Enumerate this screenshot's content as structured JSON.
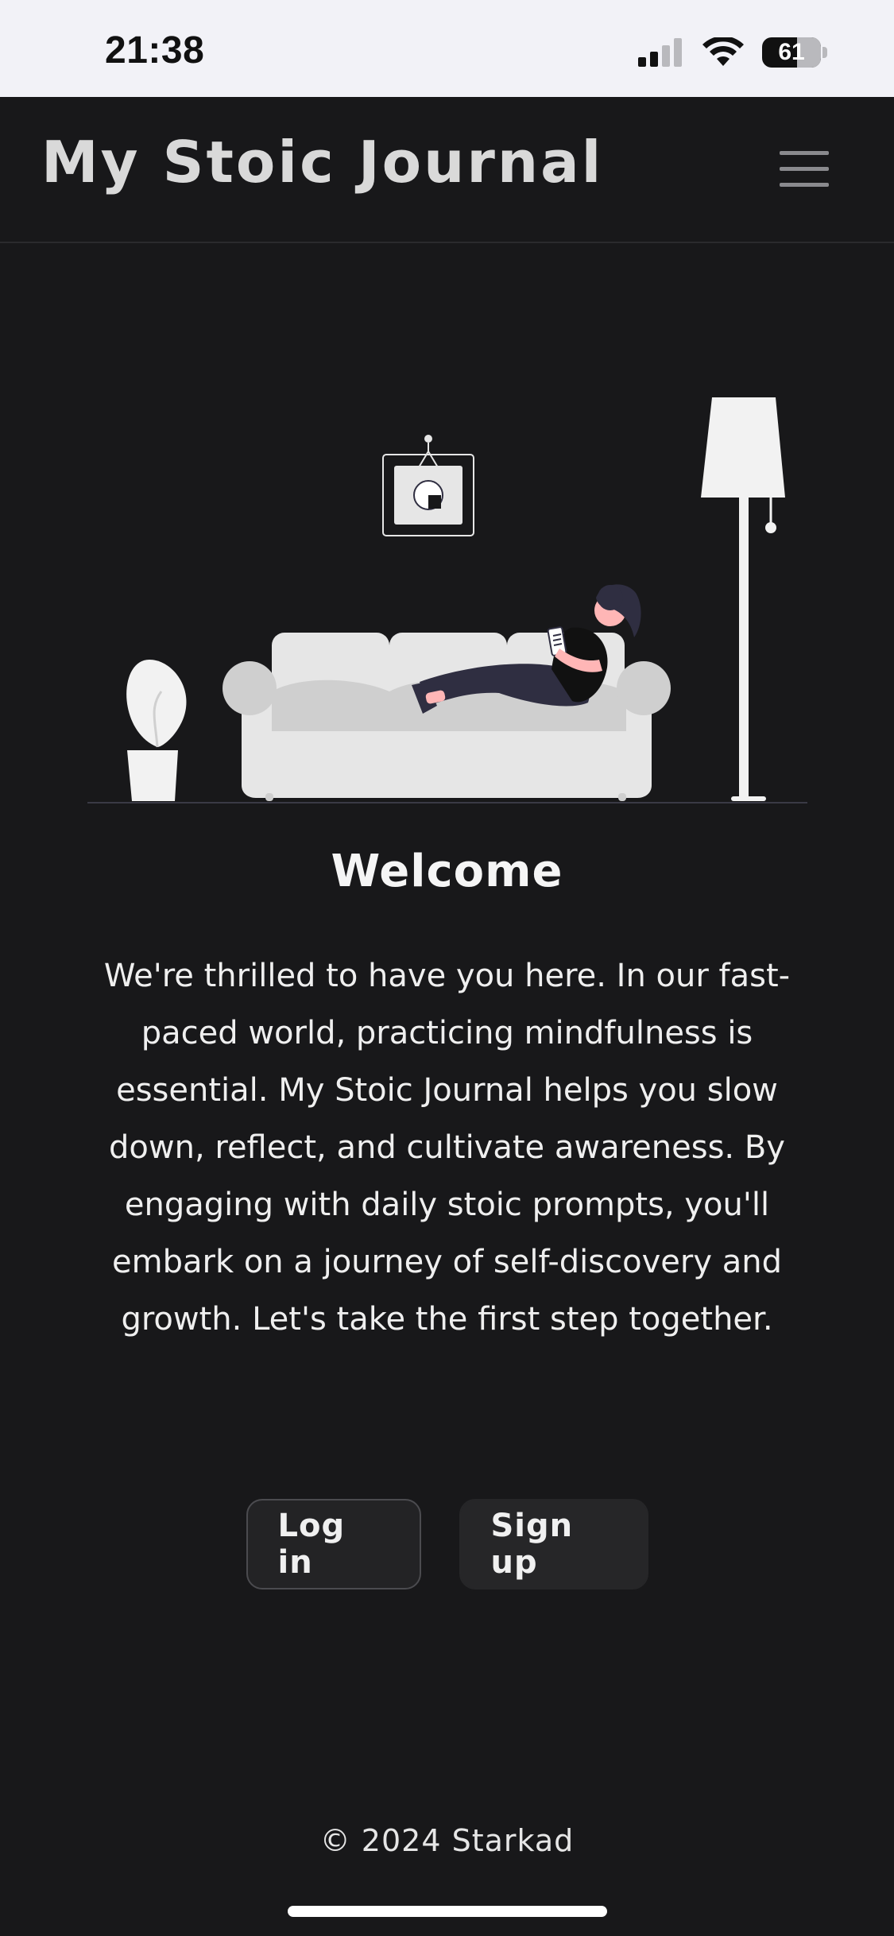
{
  "status_bar": {
    "time": "21:38",
    "battery_level": "61",
    "icons": [
      "cellular-signal-icon",
      "wifi-icon",
      "battery-icon"
    ]
  },
  "header": {
    "title": "My Stoic Journal",
    "menu_icon": "hamburger-menu-icon"
  },
  "hero": {
    "illustration": "woman-reading-on-sofa-illustration"
  },
  "welcome": {
    "title": "Welcome",
    "text": "We're thrilled to have you here. In our fast-paced world, practicing mindfulness is essential. My Stoic Journal helps you slow down, reflect, and cultivate awareness. By engaging with daily stoic prompts, you'll embark on a journey of self-discovery and growth. Let's take the first step together."
  },
  "actions": {
    "login_label": "Log in",
    "signup_label": "Sign up"
  },
  "footer": {
    "copyright": "© 2024 Starkad"
  },
  "colors": {
    "background": "#18181a",
    "status_bar": "#f2f2f7",
    "brand_text": "#d9d9d9",
    "button_bg": "#232325",
    "illustration_light": "#e6e6e6",
    "illustration_dark": "#2f2e41",
    "skin": "#ffb6b6"
  }
}
